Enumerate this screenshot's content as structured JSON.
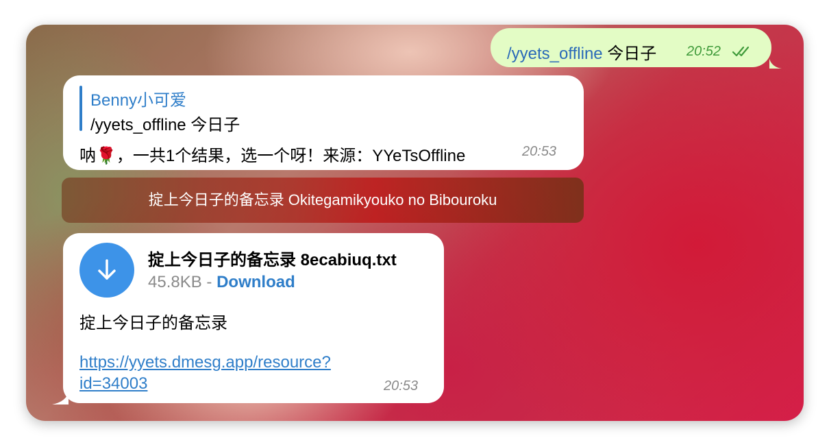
{
  "outgoing": {
    "command": "/yyets_offline",
    "query": "今日子",
    "time": "20:52",
    "status_icon": "double-check-icon"
  },
  "reply": {
    "quote_author": "Benny小可爱",
    "quote_text": "/yyets_offline 今日子",
    "text": "呐🌹，一共1个结果，选一个呀！来源：YYeTsOffline",
    "time": "20:53"
  },
  "inline_button": {
    "label": "掟上今日子的备忘录 Okitegamikyouko no Bibouroku"
  },
  "file_message": {
    "file_name": "掟上今日子的备忘录 8ecabiuq.txt",
    "size": "45.8KB",
    "separator": "-",
    "download_label": "Download",
    "caption": "掟上今日子的备忘录",
    "link_line1": "https://yyets.dmesg.app/resource?",
    "link_line2": "id=34003",
    "time": "20:53",
    "icon": "download-arrow-icon"
  },
  "colors": {
    "outgoing_bg": "#e3fcc5",
    "link_blue": "#2f7ec9",
    "download_circle": "#3d93e8",
    "outgoing_time": "#3f9a3a"
  }
}
